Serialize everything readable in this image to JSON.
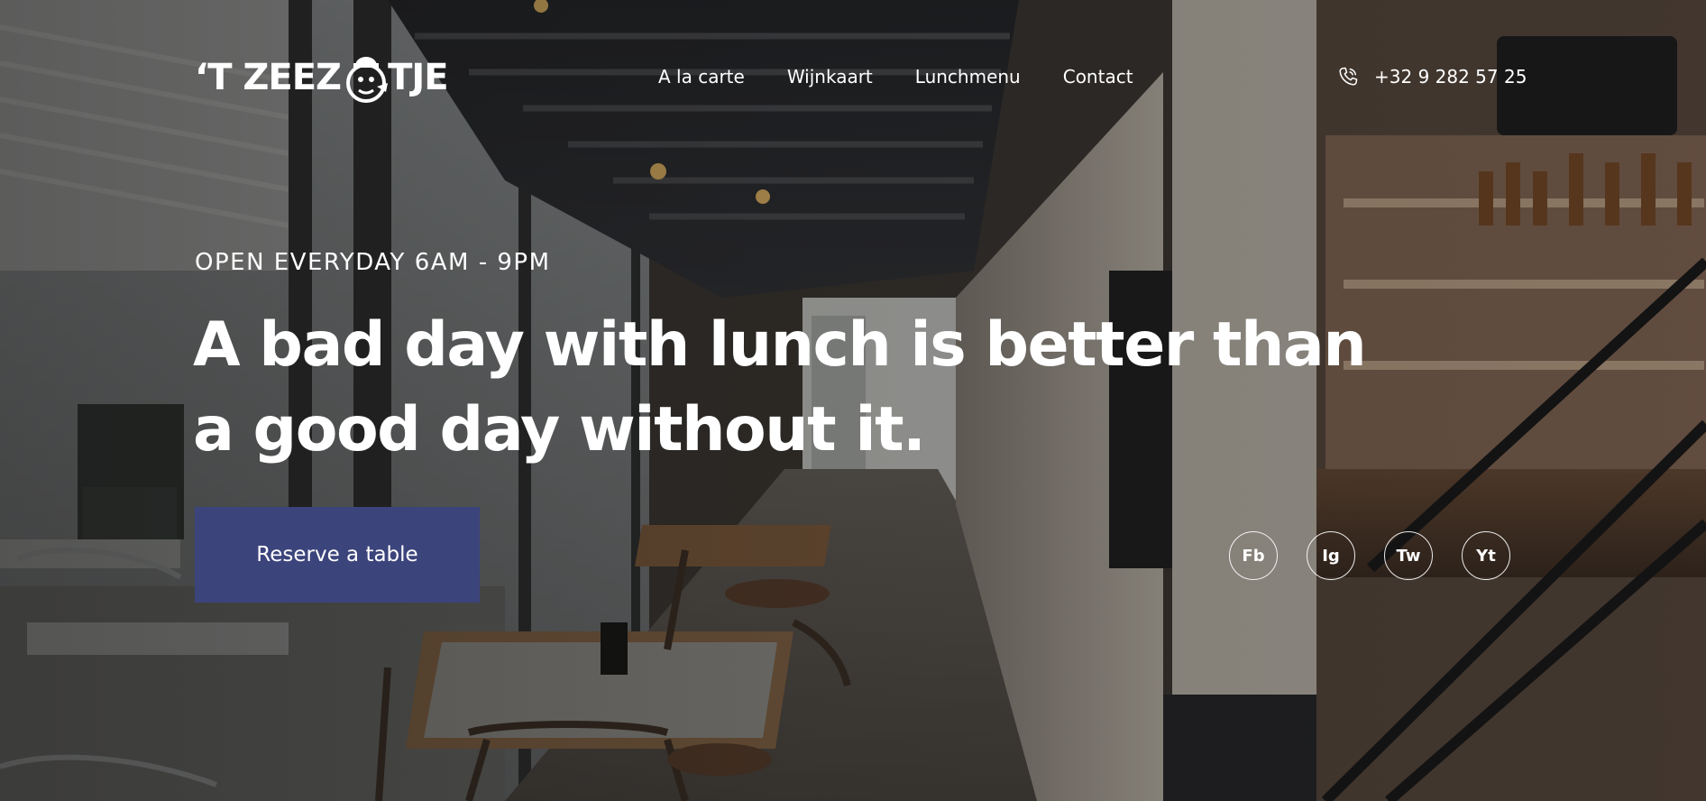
{
  "brand": {
    "logo_prefix": "‘T ZEEZ",
    "logo_suffix": "TJE",
    "mascot_icon": "mascot-icon"
  },
  "nav": {
    "items": [
      {
        "label": "A la carte"
      },
      {
        "label": "Wijnkaart"
      },
      {
        "label": "Lunchmenu"
      },
      {
        "label": "Contact"
      }
    ]
  },
  "contact": {
    "phone_icon": "phone-icon",
    "phone": "+32 9 282 57 25"
  },
  "hero": {
    "kicker": "OPEN EVERYDAY 6AM - 9PM",
    "headline": "A bad day with lunch is better than a good day without it.",
    "cta_label": "Reserve a table"
  },
  "social": {
    "items": [
      {
        "label": "Fb"
      },
      {
        "label": "Ig"
      },
      {
        "label": "Tw"
      },
      {
        "label": "Yt"
      }
    ]
  },
  "colors": {
    "cta_background": "#3c447c",
    "text": "#ffffff"
  }
}
